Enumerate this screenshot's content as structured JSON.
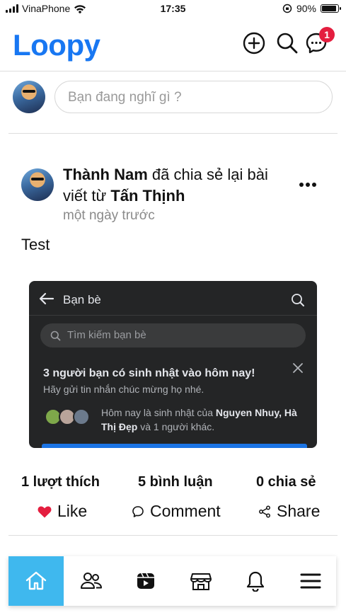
{
  "status_bar": {
    "carrier": "VinaPhone",
    "time": "17:35",
    "battery": "90%",
    "battery_level": 0.9
  },
  "header": {
    "logo": "Loopy",
    "messages_badge": "1"
  },
  "composer": {
    "placeholder": "Bạn đang nghĩ gì ?"
  },
  "post": {
    "author": "Thành Nam",
    "action_text_1": "đã chia sẻ lại",
    "action_text_2": "bài viết từ",
    "original_author": "Tấn Thịnh",
    "time_ago": "một ngày trước",
    "text": "Test",
    "shared_image": {
      "title": "Bạn bè",
      "search_placeholder": "Tìm kiếm bạn bè",
      "birthday_title": "3 người bạn có sinh nhật vào hôm nay!",
      "birthday_subtitle": "Hãy gửi tin nhắn chúc mừng họ nhé.",
      "birthday_prefix": "Hôm nay là sinh nhật của ",
      "birthday_names": "Nguyen Nhuy, Hà Thị Đẹp",
      "birthday_suffix": " và 1 người khác."
    },
    "stats": {
      "likes": "1 lượt thích",
      "comments": "5 bình luận",
      "shares": "0 chia sẻ"
    },
    "actions": {
      "like": "Like",
      "comment": "Comment",
      "share": "Share"
    }
  },
  "colors": {
    "brand": "#1877f2",
    "active_tab": "#3fb8ee",
    "like_red": "#e41e3f"
  },
  "bottom_nav": [
    "home-icon",
    "friends-icon",
    "watch-icon",
    "marketplace-icon",
    "notifications-icon",
    "menu-icon"
  ]
}
